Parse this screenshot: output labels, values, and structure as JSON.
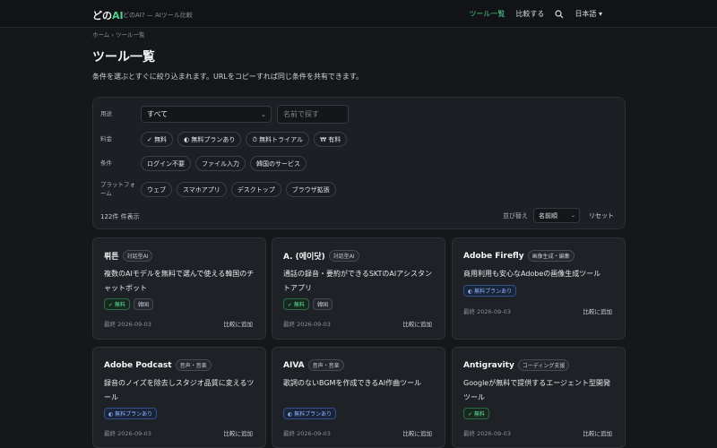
{
  "header": {
    "logo_prefix": "どの",
    "logo_accent": "AI",
    "tagline": "どのAI? — AIツール比較",
    "nav_tools": "ツール一覧",
    "nav_compare": "比較する",
    "lang": "日本語",
    "lang_chevron": "▾"
  },
  "breadcrumb": "ホーム › ツール一覧",
  "page": {
    "title": "ツール一覧",
    "description": "条件を選ぶとすぐに絞り込まれます。URLをコピーすれば同じ条件を共有できます。"
  },
  "filters": {
    "use_label": "用途",
    "use_value": "すべて",
    "name_placeholder": "名前で探す",
    "price_label": "料金",
    "price_chips": [
      "✓ 無料",
      "◐ 無料プランあり",
      "⏱ 無料トライアル",
      "₩ 有料"
    ],
    "cond_label": "条件",
    "cond_chips": [
      "ログイン不要",
      "ファイル入力",
      "韓国のサービス"
    ],
    "platform_label": "プラットフォーム",
    "platform_chips": [
      "ウェブ",
      "スマホアプリ",
      "デスクトップ",
      "ブラウザ拡張"
    ],
    "count": "122件 件表示",
    "sort_label": "並び替え",
    "sort_value": "名前順",
    "reset": "リセット"
  },
  "cards": [
    {
      "name": "뤼튼",
      "category": "対話型AI",
      "desc": "複数のAIモデルを無料で選んで使える韓国のチャットボット",
      "badges": [
        {
          "text": "✓ 無料",
          "kind": "green"
        },
        {
          "text": "韓国",
          "kind": "gray"
        }
      ],
      "date": "最終 2026-09-03",
      "compare": "比較に追加"
    },
    {
      "name": "A. (에이닷)",
      "category": "対話型AI",
      "desc": "通話の録音・要約ができるSKTのAIアシスタントアプリ",
      "badges": [
        {
          "text": "✓ 無料",
          "kind": "green"
        },
        {
          "text": "韓国",
          "kind": "gray"
        }
      ],
      "date": "最終 2026-09-03",
      "compare": "比較に追加"
    },
    {
      "name": "Adobe Firefly",
      "category": "画像生成・編集",
      "desc": "商用利用も安心なAdobeの画像生成ツール",
      "badges": [
        {
          "text": "◐ 無料プランあり",
          "kind": "blue"
        }
      ],
      "date": "最終 2026-09-03",
      "compare": "比較に追加"
    },
    {
      "name": "Adobe Podcast",
      "category": "音声・音楽",
      "desc": "録音のノイズを除去しスタジオ品質に変えるツール",
      "badges": [
        {
          "text": "◐ 無料プランあり",
          "kind": "blue"
        }
      ],
      "date": "最終 2026-09-03",
      "compare": "比較に追加"
    },
    {
      "name": "AIVA",
      "category": "音声・音楽",
      "desc": "歌詞のないBGMを作成できるAI作曲ツール",
      "badges": [
        {
          "text": "◐ 無料プランあり",
          "kind": "blue"
        }
      ],
      "date": "最終 2026-09-03",
      "compare": "比較に追加"
    },
    {
      "name": "Antigravity",
      "category": "コーディング支援",
      "desc": "Googleが無料で提供するエージェント型開発ツール",
      "badges": [
        {
          "text": "✓ 無料",
          "kind": "green"
        }
      ],
      "date": "最終 2026-09-03",
      "compare": "比較に追加"
    }
  ],
  "colors": {
    "accent": "#4fd18b",
    "background": "#15171b",
    "card": "#1e2126"
  }
}
